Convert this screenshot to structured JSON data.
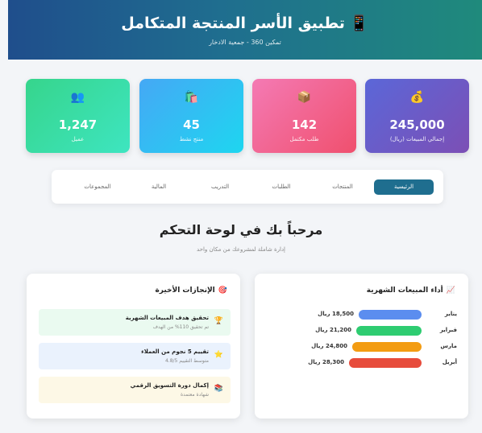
{
  "header": {
    "title": "تطبيق الأسر المنتجة المتكامل",
    "title_icon": "📱",
    "subtitle": "تمكين 360 - جمعية الادخار"
  },
  "stats": [
    {
      "icon": "💰",
      "value": "245,000",
      "label": "إجمالي المبيعات (ريال)",
      "color_from": "#5b67d8",
      "color_to": "#7c4fb5"
    },
    {
      "icon": "📦",
      "value": "142",
      "label": "طلب مكتمل",
      "color_from": "#f47ab4",
      "color_to": "#f0506e"
    },
    {
      "icon": "🛍️",
      "value": "45",
      "label": "منتج نشط",
      "color_from": "#45a8f5",
      "color_to": "#1ed6f0"
    },
    {
      "icon": "👥",
      "value": "1,247",
      "label": "عميل",
      "color_from": "#36d58c",
      "color_to": "#3ee5c0"
    }
  ],
  "nav": {
    "tabs": [
      "الرئيسية",
      "المنتجات",
      "الطلبات",
      "التدريب",
      "المالية",
      "المجموعات"
    ],
    "active_index": 0
  },
  "welcome": {
    "title": "مرحباً بك في لوحة التحكم",
    "subtitle": "إدارة شاملة لمشروعك من مكان واحد"
  },
  "sales_panel": {
    "title": "أداء المبيعات الشهرية",
    "title_icon": "📈",
    "rows": [
      {
        "month": "يناير",
        "amount": "18,500 ريال",
        "value": 18500,
        "color": "#5b8def"
      },
      {
        "month": "فبراير",
        "amount": "21,200 ريال",
        "value": 21200,
        "color": "#2ecc71"
      },
      {
        "month": "مارس",
        "amount": "24,800 ريال",
        "value": 24800,
        "color": "#f39c12"
      },
      {
        "month": "أبريل",
        "amount": "28,300 ريال",
        "value": 28300,
        "color": "#e74c3c"
      }
    ]
  },
  "achievements_panel": {
    "title": "الإنجازات الأخيرة",
    "title_icon": "🎯",
    "items": [
      {
        "icon": "🏆",
        "title": "تحقيق هدف المبيعات الشهرية",
        "sub": "تم تحقيق 110% من الهدف",
        "bg": "#eafaf0"
      },
      {
        "icon": "⭐",
        "title": "تقييم 5 نجوم من العملاء",
        "sub": "متوسط التقييم 4.8/5",
        "bg": "#eaf2fd"
      },
      {
        "icon": "📚",
        "title": "إكمال دورة التسويق الرقمي",
        "sub": "شهادة معتمدة",
        "bg": "#fdf8e6"
      }
    ]
  }
}
